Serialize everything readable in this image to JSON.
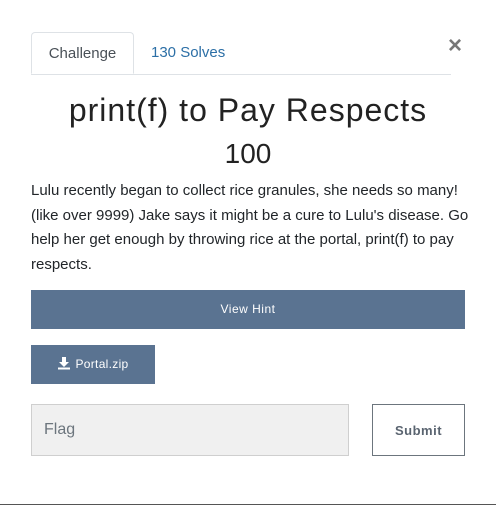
{
  "close": {
    "glyph": "×"
  },
  "tabs": [
    {
      "label": "Challenge",
      "active": true
    },
    {
      "label": "130 Solves",
      "active": false
    }
  ],
  "challenge": {
    "name": "print(f) to Pay Respects",
    "value": "100",
    "description": "Lulu recently began to collect rice granules, she needs so many! (like over 9999) Jake says it might be a cure to Lulu's disease. Go help her get enough by throwing rice at the portal, print(f) to pay respects."
  },
  "hint": {
    "label": "View Hint"
  },
  "files": [
    {
      "name": "Portal.zip",
      "icon": "download-icon"
    }
  ],
  "flag_input": {
    "placeholder": "Flag",
    "value": ""
  },
  "submit": {
    "label": "Submit"
  },
  "colors": {
    "button_bg": "#5a7391",
    "link": "#2c6fa6"
  }
}
